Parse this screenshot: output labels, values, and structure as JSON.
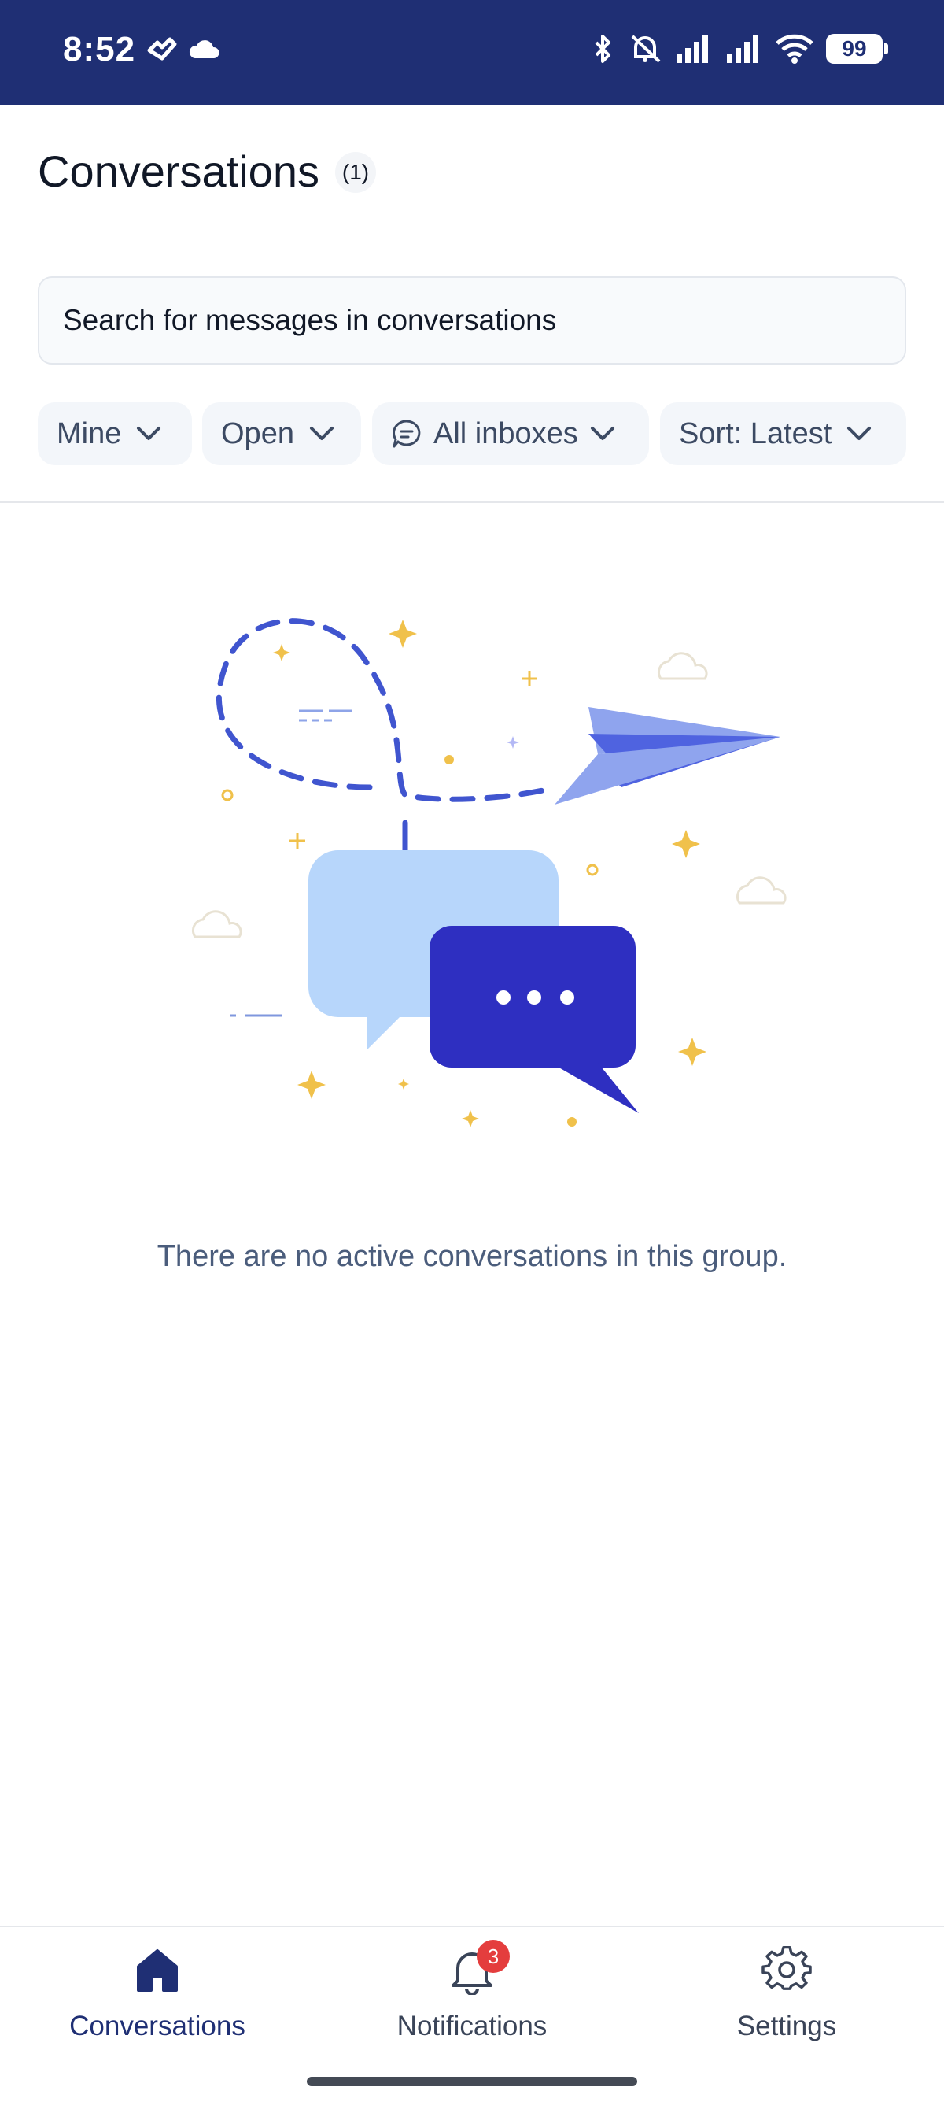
{
  "status_bar": {
    "time": "8:52",
    "battery": "99",
    "left_icons": [
      "notification-app-icon",
      "cloud-icon"
    ],
    "right_icons": [
      "bluetooth-icon",
      "muted-bell-icon",
      "signal-icon",
      "signal-icon",
      "wifi-icon",
      "battery-icon"
    ]
  },
  "header": {
    "title": "Conversations",
    "count": "(1)"
  },
  "search": {
    "placeholder": "Search for messages in conversations"
  },
  "filters": [
    {
      "label": "Mine"
    },
    {
      "label": "Open"
    },
    {
      "label": "All inboxes"
    },
    {
      "label": "Sort: Latest"
    }
  ],
  "empty_state": {
    "message": "There are no active conversations in this group."
  },
  "bottom_nav": {
    "items": [
      {
        "label": "Conversations",
        "icon": "home-icon",
        "active": true
      },
      {
        "label": "Notifications",
        "icon": "bell-icon",
        "badge": "3"
      },
      {
        "label": "Settings",
        "icon": "gear-icon"
      }
    ]
  },
  "colors": {
    "status_bar": "#1f2f74",
    "accent": "#1f2f74",
    "badge": "#e43d3d",
    "illustration_dark": "#2e2fc1",
    "illustration_light": "#b7d6fb"
  }
}
